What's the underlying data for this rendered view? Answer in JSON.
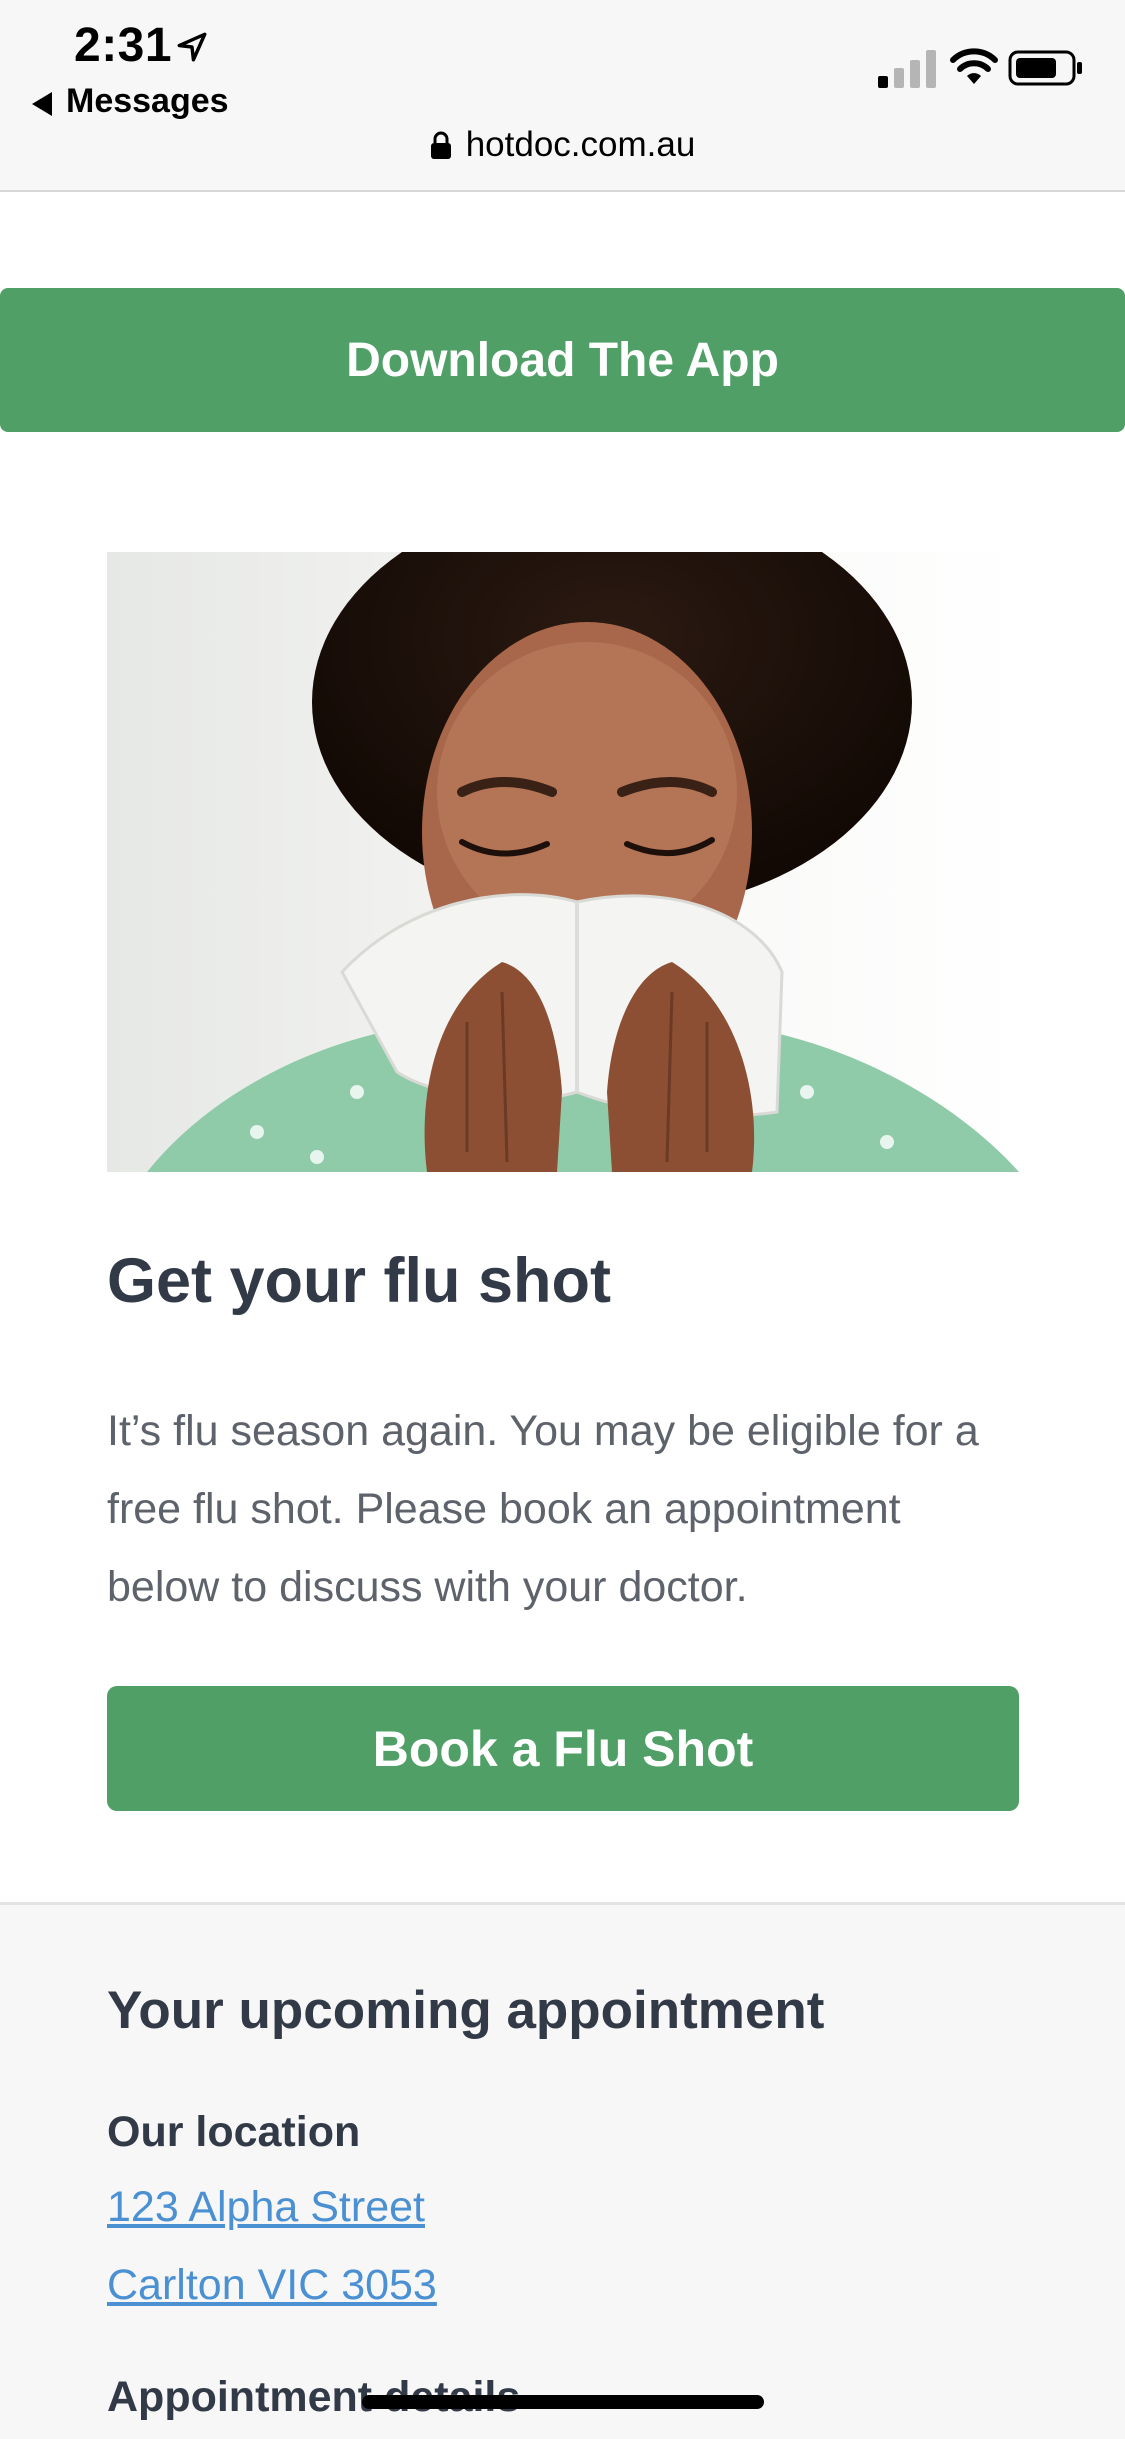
{
  "status_bar": {
    "time": "2:31",
    "back_label": "Messages",
    "url": "hotdoc.com.au"
  },
  "icons": [
    "location-arrow-icon",
    "back-triangle-icon",
    "signal-icon",
    "wifi-icon",
    "battery-icon",
    "lock-icon"
  ],
  "download_button": {
    "label": "Download The App"
  },
  "hero": {
    "title": "Get your flu shot"
  },
  "description": "It’s flu season again. You may be eligible for a free flu shot. Please book an appointment below to discuss with your doctor.",
  "book_button": {
    "label": "Book a Flu Shot"
  },
  "appointment": {
    "title": "Your upcoming appointment",
    "location_label": "Our location",
    "address_line1": "123 Alpha Street",
    "address_line2": "Carlton VIC 3053",
    "details_label": "Appointment details"
  },
  "colors": {
    "brand_green": "#4f9f66",
    "link_blue": "#4a90d2",
    "heading": "#333a47"
  }
}
